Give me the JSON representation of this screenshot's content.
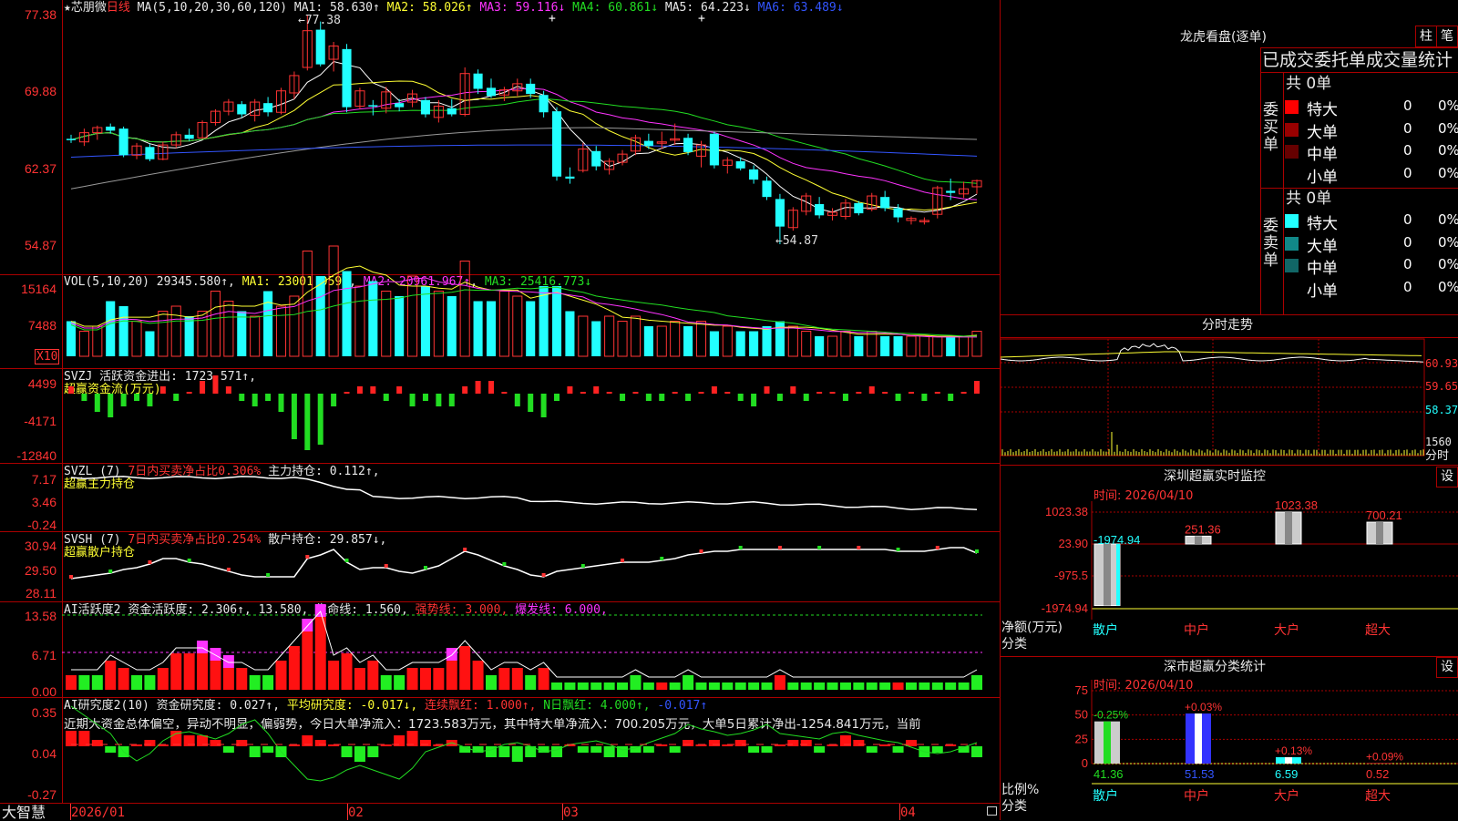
{
  "main": {
    "stock_label": "★芯朋微",
    "period": "日线",
    "ma_title": "MA(5,10,20,30,60,120)",
    "ma1": "MA1: 58.630↑",
    "ma2": "MA2: 58.026↑",
    "ma3": "MA3: 59.116↓",
    "ma4": "MA4: 60.861↓",
    "ma5": "MA5: 64.223↓",
    "ma6": "MA6: 63.489↓",
    "high_mark": "77.38",
    "low_mark": "←54.87",
    "yticks": [
      "77.38",
      "69.88",
      "62.37",
      "54.87"
    ]
  },
  "vol": {
    "title": "VOL(5,10,20)",
    "val": "29345.580↑",
    "ma1": "MA1: 23001.059↑",
    "ma2": "MA2: 20961.967↑",
    "ma3": "MA3: 25416.773↓",
    "yticks": [
      "15164",
      "7488"
    ],
    "unit": "X10"
  },
  "svzj": {
    "title": "SVZJ",
    "line1": "活跃资金进出: 1723.571↑,",
    "sub": "超赢资金流(万元)",
    "yticks": [
      "4499",
      "-4171",
      "-12840"
    ]
  },
  "svzl": {
    "title": "SVZL (7)",
    "part1": "7日内买卖净占比0.306%",
    "part2": "主力持仓: 0.112↑,",
    "sub": "超赢主力持仓",
    "yticks": [
      "7.17",
      "3.46",
      "-0.24"
    ]
  },
  "svsh": {
    "title": "SVSH (7)",
    "part1": "7日内买卖净占比0.254%",
    "part2": "散户持仓: 29.857↓,",
    "sub": "超赢散户持仓",
    "yticks": [
      "30.94",
      "29.50",
      "28.11"
    ]
  },
  "ai1": {
    "title": "AI活跃度2",
    "p1": "资金活跃度: 2.306↑,",
    "p2": "13.580,",
    "p3": "生命线: 1.560,",
    "p4": "强势线: 3.000,",
    "p5": "爆发线: 6.000,",
    "yticks": [
      "13.58",
      "6.71",
      "0.00"
    ]
  },
  "ai2": {
    "title": "AI研究度2(10)",
    "p1": "资金研究度: 0.027↑,",
    "p2": "平均研究度: -0.017↓,",
    "p3": "连续飘红: 1.000↑,",
    "p4": "N日飘红: 4.000↑,",
    "p5": "-0.017↑",
    "comment": "近期大资金总体偏空，异动不明显，偏弱势，今日大单净流入：1723.583万元，其中特大单净流入：700.205万元，大单5日累计净出-1254.841万元，当前",
    "yticks": [
      "0.35",
      "0.04",
      "-0.27"
    ]
  },
  "footer": {
    "brand": "大智慧",
    "dates": [
      "2026/01",
      "02",
      "03",
      "04"
    ]
  },
  "right": {
    "lhb_title": "龙虎看盘(逐单)",
    "btn_zhu": "柱",
    "btn_bi": "笔",
    "tabs": "已成交委托单成交量统计",
    "buy_side": "委买单",
    "sell_side": "委卖单",
    "buy_total": "共 0单",
    "sell_total": "共 0单",
    "rows": [
      {
        "label": "特大",
        "count": "0",
        "pct": "0%",
        "color": "#ff0000"
      },
      {
        "label": "大单",
        "count": "0",
        "pct": "0%",
        "color": "#990000"
      },
      {
        "label": "中单",
        "count": "0",
        "pct": "0%",
        "color": "#660000"
      },
      {
        "label": "小单",
        "count": "0",
        "pct": "0%",
        "color": "#000000"
      }
    ],
    "sell_rows": [
      {
        "label": "特大",
        "count": "0",
        "pct": "0%",
        "color": "#22ffff"
      },
      {
        "label": "大单",
        "count": "0",
        "pct": "0%",
        "color": "#118888"
      },
      {
        "label": "中单",
        "count": "0",
        "pct": "0%",
        "color": "#116666"
      },
      {
        "label": "小单",
        "count": "0",
        "pct": "0%",
        "color": "#000000"
      }
    ],
    "intraday_title": "分时走势",
    "intraday_yticks": [
      "60.93",
      "59.65",
      "58.37",
      "1560"
    ],
    "intraday_unit": "分时",
    "sz_title": "深圳超赢实时监控",
    "sz_btn": "设",
    "sz_time": "时间: 2026/04/10",
    "sz_yticks": [
      "1023.38",
      "23.90",
      "-975.5",
      "-1974.94"
    ],
    "sz_vals": [
      "-1974.94",
      "251.36",
      "1023.38",
      "700.21"
    ],
    "sz_unit1": "净额(万元)",
    "sz_unit2": "分类",
    "cats": [
      "散户",
      "中户",
      "大户",
      "超大"
    ],
    "cls_title": "深市超赢分类统计",
    "cls_btn": "设",
    "cls_time": "时间: 2026/04/10",
    "cls_yticks": [
      "75",
      "50",
      "25",
      "0"
    ],
    "cls_top": [
      "-0.25%",
      "+0.03%",
      "+0.13%",
      "+0.09%"
    ],
    "cls_vals": [
      "41.36",
      "51.53",
      "6.59",
      "0.52"
    ],
    "cls_unit1": "比例%",
    "cls_unit2": "分类"
  },
  "chart_data": {
    "type": "candlestick",
    "ohlc": [
      [
        65.2,
        65.6,
        64.8,
        65.1
      ],
      [
        64.9,
        66.2,
        64.5,
        65.8
      ],
      [
        65.8,
        66.5,
        65.1,
        66.3
      ],
      [
        66.4,
        66.7,
        65.7,
        66.0
      ],
      [
        66.2,
        66.4,
        63.4,
        63.6
      ],
      [
        63.6,
        64.8,
        63.2,
        64.5
      ],
      [
        64.4,
        64.7,
        63.0,
        63.2
      ],
      [
        63.2,
        64.9,
        63.1,
        64.6
      ],
      [
        64.6,
        65.9,
        64.3,
        65.6
      ],
      [
        65.6,
        66.2,
        65.0,
        65.2
      ],
      [
        65.3,
        67.0,
        65.2,
        66.8
      ],
      [
        66.8,
        68.1,
        66.5,
        67.9
      ],
      [
        67.9,
        69.1,
        67.5,
        68.8
      ],
      [
        68.6,
        68.9,
        67.3,
        67.6
      ],
      [
        67.5,
        69.1,
        66.9,
        68.8
      ],
      [
        68.7,
        69.3,
        67.4,
        67.8
      ],
      [
        67.8,
        70.2,
        67.6,
        69.9
      ],
      [
        69.7,
        71.8,
        69.1,
        71.4
      ],
      [
        72.2,
        77.38,
        71.9,
        75.8
      ],
      [
        75.9,
        76.7,
        72.3,
        72.5
      ],
      [
        73.0,
        74.7,
        71.8,
        74.3
      ],
      [
        74.0,
        74.5,
        67.8,
        68.3
      ],
      [
        68.4,
        70.2,
        68.1,
        69.9
      ],
      [
        68.5,
        69.0,
        67.5,
        68.4
      ],
      [
        68.2,
        70.3,
        67.7,
        69.8
      ],
      [
        68.7,
        69.1,
        67.9,
        68.3
      ],
      [
        68.8,
        70.0,
        68.3,
        69.6
      ],
      [
        69.0,
        69.3,
        67.3,
        67.6
      ],
      [
        67.3,
        69.0,
        66.8,
        68.4
      ],
      [
        68.2,
        69.1,
        67.4,
        67.6
      ],
      [
        67.6,
        72.2,
        67.4,
        71.6
      ],
      [
        71.6,
        72.0,
        69.6,
        70.1
      ],
      [
        70.2,
        71.1,
        69.2,
        69.4
      ],
      [
        69.5,
        70.3,
        68.9,
        70.0
      ],
      [
        69.9,
        71.1,
        69.4,
        70.6
      ],
      [
        70.6,
        71.1,
        69.2,
        69.6
      ],
      [
        69.5,
        69.9,
        67.3,
        67.8
      ],
      [
        67.9,
        68.3,
        61.1,
        61.5
      ],
      [
        61.5,
        62.4,
        60.8,
        61.3
      ],
      [
        62.1,
        64.8,
        61.9,
        64.2
      ],
      [
        64.0,
        64.5,
        62.1,
        62.5
      ],
      [
        62.2,
        63.3,
        61.7,
        63.0
      ],
      [
        62.9,
        64.1,
        62.6,
        63.7
      ],
      [
        64.0,
        65.6,
        63.6,
        65.3
      ],
      [
        65.0,
        65.7,
        64.2,
        64.5
      ],
      [
        64.8,
        65.9,
        64.2,
        64.9
      ],
      [
        65.1,
        66.7,
        64.6,
        65.2
      ],
      [
        65.3,
        65.7,
        63.6,
        63.9
      ],
      [
        63.5,
        65.0,
        62.4,
        64.6
      ],
      [
        65.7,
        65.9,
        62.3,
        62.6
      ],
      [
        62.6,
        63.4,
        61.8,
        63.1
      ],
      [
        63.0,
        63.4,
        62.1,
        62.3
      ],
      [
        62.2,
        62.6,
        60.8,
        61.2
      ],
      [
        61.1,
        61.5,
        59.2,
        59.5
      ],
      [
        59.3,
        59.8,
        54.87,
        56.6
      ],
      [
        56.5,
        58.5,
        56.2,
        58.2
      ],
      [
        58.1,
        59.9,
        57.7,
        59.6
      ],
      [
        58.8,
        59.5,
        57.4,
        57.7
      ],
      [
        57.7,
        58.4,
        57.2,
        58.0
      ],
      [
        57.6,
        59.3,
        57.3,
        58.9
      ],
      [
        58.9,
        59.1,
        57.7,
        57.9
      ],
      [
        58.3,
        59.9,
        58.1,
        59.6
      ],
      [
        59.5,
        60.1,
        58.1,
        58.4
      ],
      [
        58.4,
        58.8,
        57.0,
        57.5
      ],
      [
        57.2,
        57.6,
        56.8,
        57.4
      ],
      [
        57.1,
        57.5,
        56.8,
        57.2
      ],
      [
        57.8,
        60.6,
        57.4,
        60.4
      ],
      [
        60.1,
        61.3,
        59.2,
        59.9
      ],
      [
        59.8,
        61.0,
        59.4,
        60.3
      ],
      [
        60.5,
        61.2,
        59.8,
        61.1
      ]
    ],
    "volume": [
      0.7,
      0.5,
      0.6,
      1.1,
      1.0,
      0.7,
      0.5,
      0.9,
      1.0,
      0.8,
      0.9,
      1.3,
      1.1,
      0.9,
      0.8,
      1.3,
      1.0,
      1.2,
      2.1,
      1.6,
      2.2,
      1.7,
      1.4,
      1.5,
      1.3,
      1.2,
      1.6,
      1.4,
      1.3,
      1.2,
      1.9,
      1.1,
      1.1,
      1.3,
      1.2,
      1.1,
      1.4,
      1.4,
      0.9,
      0.8,
      0.7,
      0.8,
      0.7,
      0.8,
      0.6,
      0.6,
      0.7,
      0.6,
      0.7,
      0.5,
      0.6,
      0.5,
      0.5,
      0.6,
      0.7,
      0.6,
      0.5,
      0.4,
      0.4,
      0.5,
      0.4,
      0.5,
      0.4,
      0.4,
      0.4,
      0.4,
      0.4,
      0.4,
      0.4,
      0.5
    ]
  }
}
